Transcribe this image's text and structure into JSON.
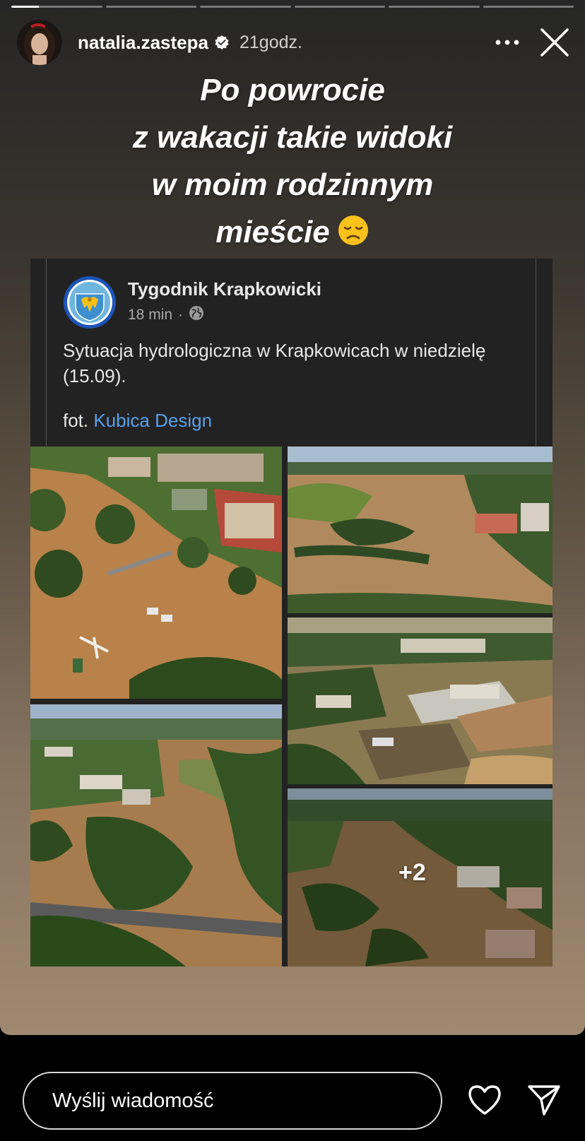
{
  "story": {
    "progress": [
      0.3,
      0,
      0,
      0,
      0,
      0
    ],
    "username": "natalia.zastepa",
    "time": "21godz.",
    "caption_lines": [
      "Po powrocie",
      "z wakacji takie widoki",
      "w moim rodzinnym",
      "mieście"
    ]
  },
  "post": {
    "page_name": "Tygodnik Krapkowicki",
    "meta_time": "18 min",
    "meta_dot": "·",
    "text": "Sytuacja hydrologiczna w Krapkowicach w niedzielę (15.09).",
    "credit_prefix": "fot.",
    "credit_link": "Kubica Design",
    "more_photos": "+2"
  },
  "reply": {
    "placeholder": "Wyślij wiadomość"
  }
}
